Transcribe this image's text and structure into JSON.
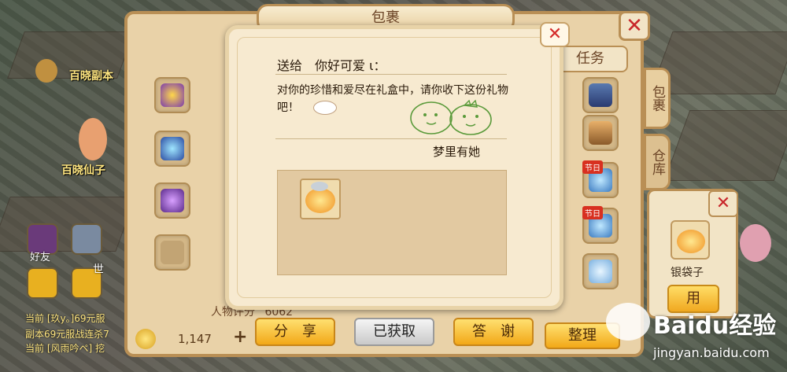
{
  "world": {
    "npc_names": [
      "百晓副本",
      "百晓仙子"
    ],
    "chat_lines": [
      "当前 [玖y。]69元服",
      "副本69元服战连杀7",
      "当前 [风雨吟ペ] 挖"
    ],
    "social_label": "好友",
    "mic_label": "世"
  },
  "bag": {
    "title": "包裹",
    "tab_task": "任务",
    "side_tabs": [
      "包裹",
      "仓库"
    ],
    "rating_label": "人物评分",
    "rating_value": "6062",
    "gold_value": "1,147",
    "sort_label": "整理",
    "badge_label": "节日"
  },
  "detail": {
    "item_name": "银袋子",
    "use_label": "用"
  },
  "gift": {
    "to_label": "送给",
    "to_name": "你好可爱 ι：",
    "message": "对你的珍惜和爱尽在礼盒中，请你收下这份礼物吧！",
    "signature": "梦里有她"
  },
  "actions": {
    "share": "分　享",
    "received": "已获取",
    "thanks": "答　谢"
  },
  "watermark": {
    "brand": "Baidu经验",
    "url": "jingyan.baidu.com"
  },
  "colors": {
    "panel": "#f7ead0",
    "frame": "#b98f55",
    "button_yellow": "#f2a818",
    "close_red": "#d42a2a"
  }
}
